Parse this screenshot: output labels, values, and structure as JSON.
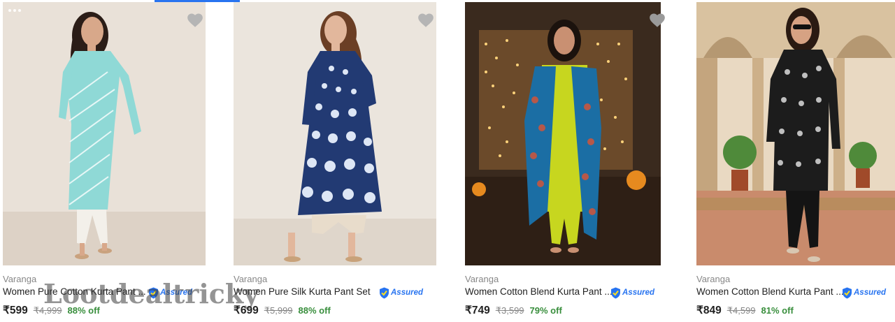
{
  "colors": {
    "accent": "#2874f0",
    "discount": "#388e3c",
    "muted": "#878787"
  },
  "products": [
    {
      "brand": "Varanga",
      "title": "Women Pure Cotton Kurta Pant ...",
      "assured_label": "Assured",
      "price": "₹599",
      "mrp": "₹4,999",
      "discount": "88% off",
      "wishlist_icon": "heart-icon"
    },
    {
      "brand": "Varanga",
      "title": "Women Pure Silk Kurta Pant Set",
      "assured_label": "Assured",
      "price": "₹699",
      "mrp": "₹5,999",
      "discount": "88% off",
      "wishlist_icon": "heart-icon"
    },
    {
      "brand": "Varanga",
      "title": "Women Cotton Blend Kurta Pant ...",
      "assured_label": "Assured",
      "price": "₹749",
      "mrp": "₹3,599",
      "discount": "79% off",
      "wishlist_icon": "heart-icon"
    },
    {
      "brand": "Varanga",
      "title": "Women Cotton Blend Kurta Pant ...",
      "assured_label": "Assured",
      "price": "₹849",
      "mrp": "₹4,599",
      "discount": "81% off",
      "wishlist_icon": "heart-icon"
    }
  ],
  "watermark": "Lootdealtricky"
}
